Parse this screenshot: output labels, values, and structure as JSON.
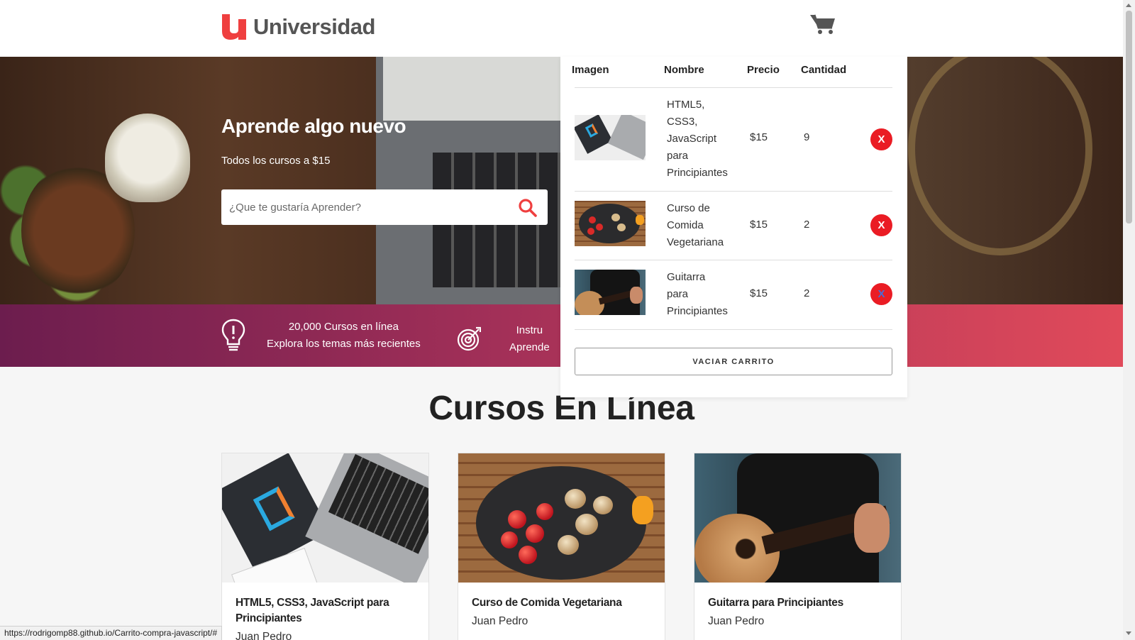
{
  "header": {
    "logo_text": "Universidad",
    "brand_color": "#ef3f3f"
  },
  "hero": {
    "title": "Aprende algo nuevo",
    "subtitle": "Todos los cursos a $15",
    "search_placeholder": "¿Que te gustaría Aprender?"
  },
  "banner": {
    "features": [
      {
        "icon": "lightbulb-icon",
        "line1": "20,000 Cursos en línea",
        "line2": "Explora los temas más recientes"
      },
      {
        "icon": "target-icon",
        "line1": "Instru",
        "line2": "Aprende"
      }
    ]
  },
  "courses": {
    "section_title": "Cursos En Línea",
    "items": [
      {
        "title": "HTML5, CSS3, JavaScript para Principiantes",
        "author": "Juan Pedro"
      },
      {
        "title": "Curso de Comida Vegetariana",
        "author": "Juan Pedro"
      },
      {
        "title": "Guitarra para Principiantes",
        "author": "Juan Pedro"
      }
    ]
  },
  "cart": {
    "headers": {
      "image": "Imagen",
      "name": "Nombre",
      "price": "Precio",
      "quantity": "Cantidad"
    },
    "rows": [
      {
        "name_lines": [
          "HTML5,",
          "CSS3,",
          "JavaScript",
          "para",
          "Principiantes"
        ],
        "price": "$15",
        "quantity": "9",
        "remove": "X"
      },
      {
        "name_lines": [
          "Curso de",
          "Comida",
          "Vegetariana"
        ],
        "price": "$15",
        "quantity": "2",
        "remove": "X"
      },
      {
        "name_lines": [
          "Guitarra",
          "para",
          "Principiantes"
        ],
        "price": "$15",
        "quantity": "2",
        "remove": "X"
      }
    ],
    "empty_button": "VACIAR CARRITO",
    "remove_color": "#ea1c24"
  },
  "status_bar": {
    "url": "https://rodrigomp88.github.io/Carrito-compra-javascript/#"
  }
}
